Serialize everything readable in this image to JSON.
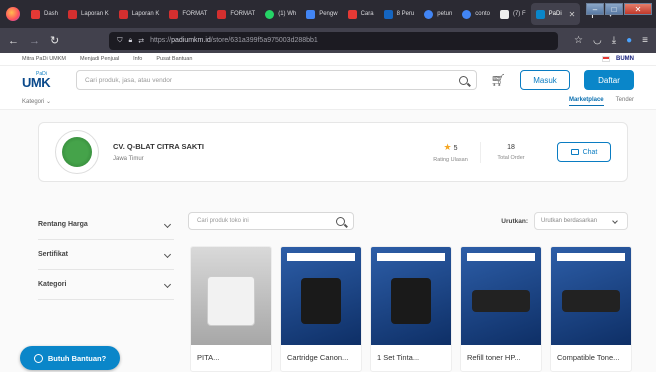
{
  "browser": {
    "tabs": [
      {
        "label": "Dash",
        "color": "#e53935"
      },
      {
        "label": "Laporan K",
        "color": "#d32f2f"
      },
      {
        "label": "Laporan K",
        "color": "#d32f2f"
      },
      {
        "label": "FORMAT",
        "color": "#d32f2f"
      },
      {
        "label": "FORMAT",
        "color": "#d32f2f"
      },
      {
        "label": "(1) Wh",
        "color": "#25d366"
      },
      {
        "label": "Pengw",
        "color": "#4285f4"
      },
      {
        "label": "Cara",
        "color": "#e53935"
      },
      {
        "label": "8 Peru",
        "color": "#1565c0"
      },
      {
        "label": "petun",
        "color": "#4285f4"
      },
      {
        "label": "conto",
        "color": "#4285f4"
      },
      {
        "label": "(7) F",
        "color": "#eeeeee"
      },
      {
        "label": "PaDi",
        "color": "#0a86c9",
        "active": true
      }
    ],
    "url_prefix": "https://",
    "url_main": "padiumkm.id",
    "url_rest": "/store/631a399f5a975003d288bb1"
  },
  "topstrip": {
    "links": [
      "Mitra PaDi UMKM",
      "Menjadi Penjual",
      "Info",
      "Pusat Bantuan"
    ],
    "brand": "BUMN"
  },
  "header": {
    "logo_top": "PaDi",
    "logo_main": "UMK",
    "search_placeholder": "Cari produk, jasa, atau vendor",
    "masuk": "Masuk",
    "daftar": "Daftar"
  },
  "subnav": {
    "kategori": "Kategori",
    "tabs": [
      "Marketplace",
      "Tender"
    ]
  },
  "store": {
    "name": "CV. Q-BLAT CITRA SAKTI",
    "location": "Jawa Timur",
    "rating": "5",
    "rating_label": "Rating Ulasan",
    "orders": "18",
    "orders_label": "Total Order",
    "chat": "Chat"
  },
  "filters": [
    "Rentang Harga",
    "Sertifikat",
    "Kategori"
  ],
  "store_search_placeholder": "Cari produk toko ini",
  "sort": {
    "label": "Urutkan:",
    "value": "Urutkan berdasarkan"
  },
  "products": [
    {
      "name": "PITA..."
    },
    {
      "name": "Cartridge Canon..."
    },
    {
      "name": "1 Set Tinta..."
    },
    {
      "name": "Refill toner HP..."
    },
    {
      "name": "Compatible Tone..."
    }
  ],
  "help": "Butuh Bantuan?"
}
